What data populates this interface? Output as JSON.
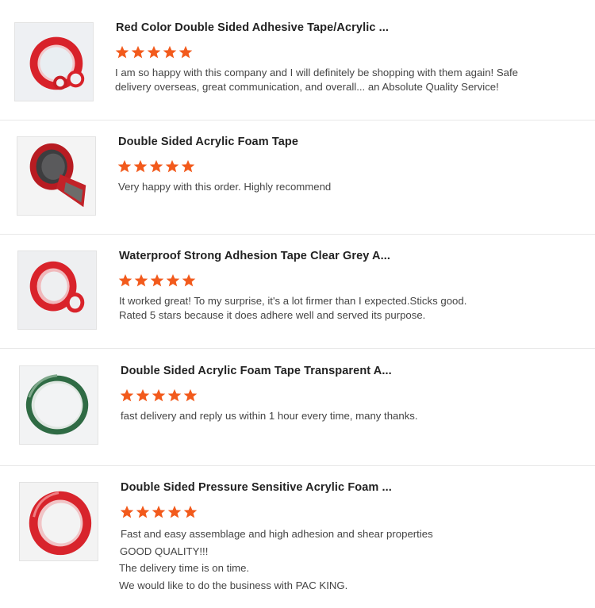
{
  "colors": {
    "star": "#f25a1c",
    "divider": "#e8e8e8",
    "title": "#222222",
    "text": "#444444"
  },
  "reviews": [
    {
      "title": "Red Color Double Sided Adhesive Tape/Acrylic ...",
      "rating": 5,
      "image_icon": "red-tape-rolls-image",
      "text_lines": [
        "I am so happy with this company and I will definitely be shopping with them again! Safe",
        "delivery overseas, great communication, and overall... an Absolute Quality Service!"
      ]
    },
    {
      "title": "Double Sided Acrylic Foam Tape",
      "rating": 5,
      "image_icon": "grey-foam-tape-roll-image",
      "text_lines": [
        "Very happy with this order. Highly recommend"
      ]
    },
    {
      "title": "Waterproof Strong Adhesion Tape Clear Grey A...",
      "rating": 5,
      "image_icon": "red-clear-tape-rolls-image",
      "text_lines": [
        "It worked great! To my surprise, it's a lot firmer than I expected.Sticks good.",
        "Rated 5 stars because it does adhere well and served its purpose."
      ]
    },
    {
      "title": "Double Sided Acrylic Foam Tape Transparent A...",
      "rating": 5,
      "image_icon": "green-transparent-tape-roll-image",
      "text_lines": [
        "fast delivery and reply us within 1 hour every time, many thanks."
      ]
    },
    {
      "title": "Double Sided Pressure Sensitive Acrylic Foam ...",
      "rating": 5,
      "image_icon": "red-pressure-tape-roll-image",
      "text_lines": [
        "Fast and easy assemblage and high adhesion and shear properties",
        "GOOD QUALITY!!!",
        "The delivery time is on time.",
        "We would like to do the business with PAC KING."
      ]
    }
  ]
}
